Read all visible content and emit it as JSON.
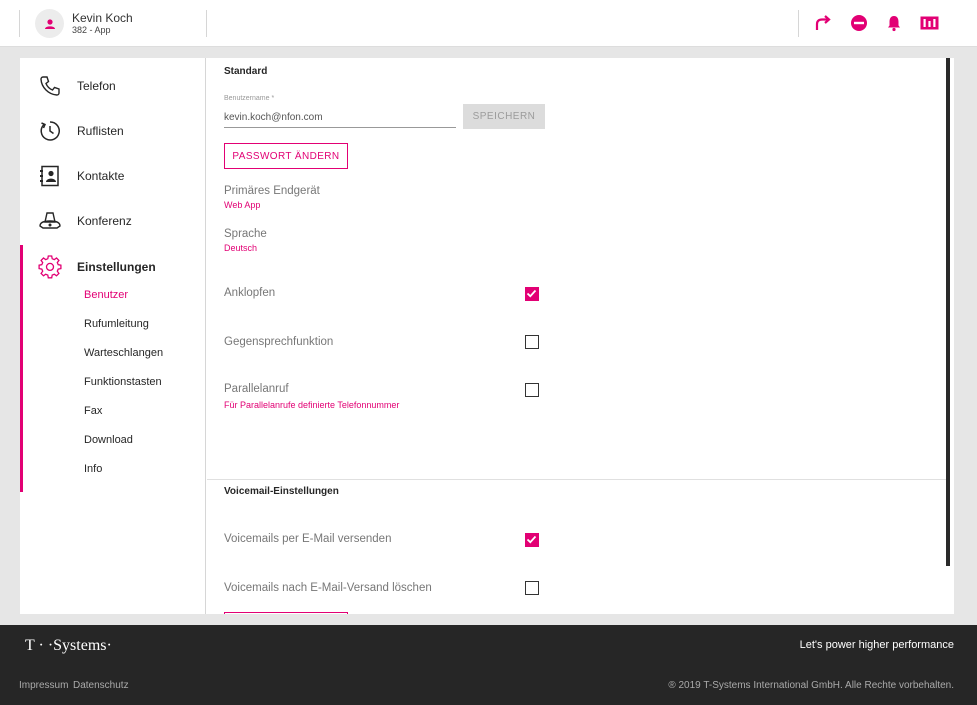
{
  "header": {
    "user_name": "Kevin Koch",
    "user_sub": "382 - App",
    "icons": [
      "forward-call-icon",
      "do-not-disturb-icon",
      "bell-icon",
      "status-panel-icon"
    ]
  },
  "sidebar": {
    "items": [
      {
        "label": "Telefon",
        "icon": "phone-icon"
      },
      {
        "label": "Ruflisten",
        "icon": "clock-icon"
      },
      {
        "label": "Kontakte",
        "icon": "contacts-icon"
      },
      {
        "label": "Konferenz",
        "icon": "conference-icon"
      },
      {
        "label": "Einstellungen",
        "icon": "gear-icon"
      }
    ],
    "subitems": [
      "Benutzer",
      "Rufumleitung",
      "Warteschlangen",
      "Funktionstasten",
      "Fax",
      "Download",
      "Info"
    ]
  },
  "standard": {
    "title": "Standard",
    "username_label": "Benutzername *",
    "username_value": "kevin.koch@nfon.com",
    "save_label": "SPEICHERN",
    "password_label": "PASSWORT ÄNDERN",
    "primary_device_label": "Primäres Endgerät",
    "primary_device_value": "Web App",
    "language_label": "Sprache",
    "language_value": "Deutsch",
    "call_waiting_label": "Anklopfen",
    "intercom_label": "Gegensprechfunktion",
    "parallel_label": "Parallelanruf",
    "parallel_sub": "Für Parallelanrufe definierte Telefonnummer"
  },
  "voicemail": {
    "title": "Voicemail-Einstellungen",
    "email_send_label": "Voicemails per E-Mail versenden",
    "email_delete_label": "Voicemails nach E-Mail-Versand löschen"
  },
  "checks": {
    "call_waiting": true,
    "intercom": false,
    "parallel": false,
    "email_send": true,
    "email_delete": false
  },
  "footer": {
    "brand": "T · ·Systems·",
    "tagline": "Let's power higher performance",
    "impressum": "Impressum",
    "datenschutz": "Datenschutz",
    "copyright": "® 2019 T-Systems International GmbH. Alle Rechte vorbehalten."
  },
  "colors": {
    "accent": "#e20074",
    "footer_bg": "#262626",
    "page_bg": "#e6e6e6"
  }
}
